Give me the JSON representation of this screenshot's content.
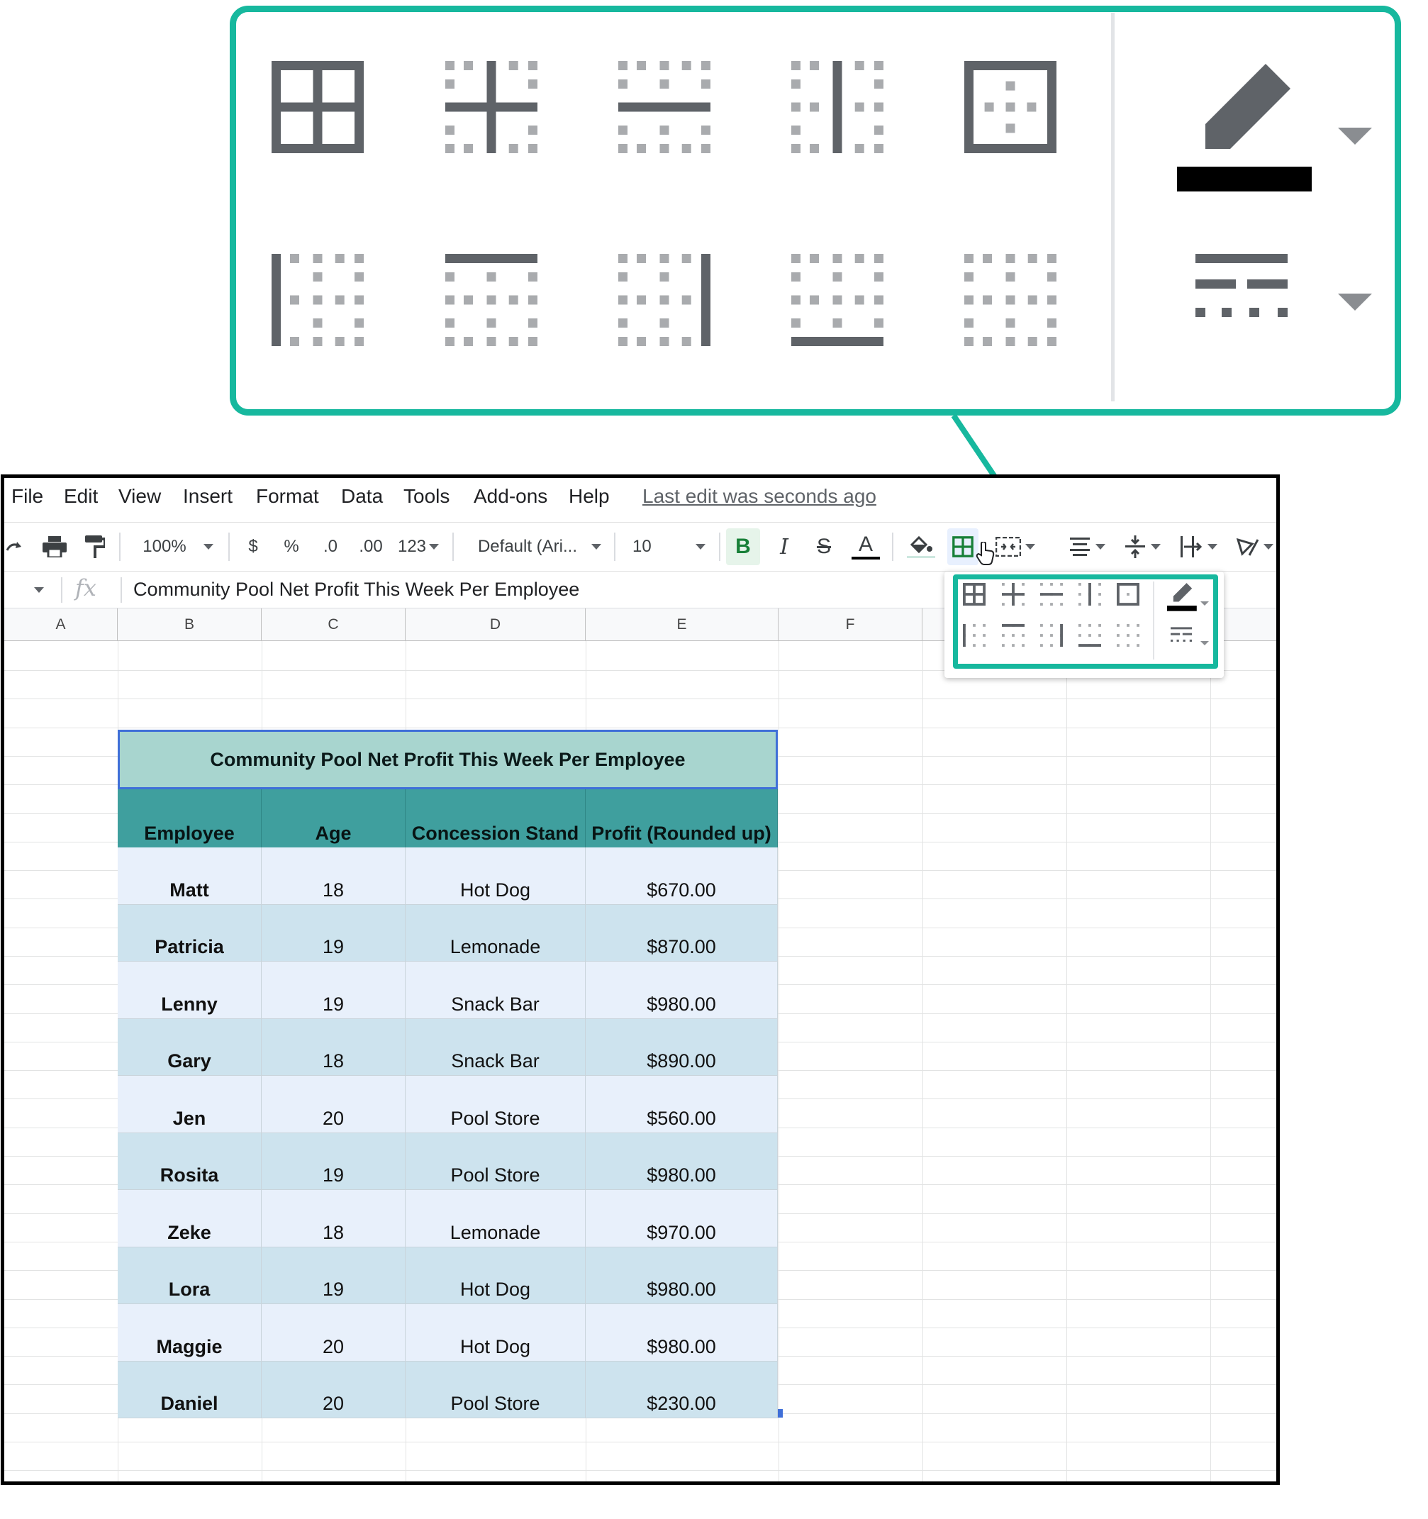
{
  "menu": {
    "items": [
      "File",
      "Edit",
      "View",
      "Insert",
      "Format",
      "Data",
      "Tools",
      "Add-ons",
      "Help"
    ],
    "last_edit": "Last edit was seconds ago"
  },
  "toolbar": {
    "zoom": "100%",
    "currency": "$",
    "percent": "%",
    "decrease_decimal": ".0",
    "increase_decimal": ".00",
    "more_formats": "123",
    "font_family": "Default (Ari...",
    "font_size": "10",
    "bold": "B",
    "italic": "I",
    "strikethrough": "S",
    "text_color": "A"
  },
  "formula_bar": {
    "fx": "fx",
    "content": "Community Pool Net Profit This Week Per Employee"
  },
  "columns": [
    "A",
    "B",
    "C",
    "D",
    "E",
    "F"
  ],
  "table": {
    "title": "Community Pool Net Profit This Week Per Employee",
    "headers": [
      "Employee",
      "Age",
      "Concession Stand",
      "Profit (Rounded up)"
    ],
    "rows": [
      [
        "Matt",
        "18",
        "Hot Dog",
        "$670.00"
      ],
      [
        "Patricia",
        "19",
        "Lemonade",
        "$870.00"
      ],
      [
        "Lenny",
        "19",
        "Snack Bar",
        "$980.00"
      ],
      [
        "Gary",
        "18",
        "Snack Bar",
        "$890.00"
      ],
      [
        "Jen",
        "20",
        "Pool Store",
        "$560.00"
      ],
      [
        "Rosita",
        "19",
        "Pool Store",
        "$980.00"
      ],
      [
        "Zeke",
        "18",
        "Lemonade",
        "$970.00"
      ],
      [
        "Lora",
        "19",
        "Hot Dog",
        "$980.00"
      ],
      [
        "Maggie",
        "20",
        "Hot Dog",
        "$980.00"
      ],
      [
        "Daniel",
        "20",
        "Pool Store",
        "$230.00"
      ]
    ]
  },
  "colors": {
    "callout_border": "#17b89e",
    "title_fill": "#a8d5cf",
    "header_fill": "#3f9f9e",
    "row_light": "#e8f0fb",
    "row_dark": "#cde3ee",
    "selection": "#3f6fd8",
    "icon_gray": "#5f6368"
  },
  "border_menu": {
    "icons": [
      "all-borders-icon",
      "inner-borders-icon",
      "horizontal-borders-icon",
      "vertical-borders-icon",
      "outer-borders-icon",
      "left-border-icon",
      "top-border-icon",
      "right-border-icon",
      "bottom-border-icon",
      "clear-borders-icon",
      "border-color-icon",
      "border-style-icon"
    ]
  }
}
